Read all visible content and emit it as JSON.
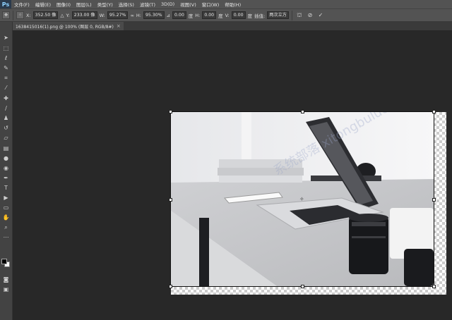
{
  "app": {
    "logo": "Ps"
  },
  "menu": [
    "文件(F)",
    "编辑(E)",
    "图像(I)",
    "图层(L)",
    "类型(Y)",
    "选择(S)",
    "滤镜(T)",
    "3D(D)",
    "视图(V)",
    "窗口(W)",
    "帮助(H)"
  ],
  "options": {
    "x_label": "X:",
    "x_value": "352.50 像",
    "y_label": "Y:",
    "y_value": "233.00 像",
    "w_label": "W:",
    "w_value": "95.27%",
    "h_label": "H:",
    "h_value": "95.30%",
    "angle_value": "0.00",
    "angle_unit": "度",
    "hskew_label": "H:",
    "hskew_value": "0.00",
    "hskew_unit": "度",
    "vskew_label": "V:",
    "vskew_value": "0.00",
    "vskew_unit": "度",
    "interp_label": "插值:",
    "interp_value": "两次立方"
  },
  "document": {
    "tab_title": "1638415016(1).png @ 100% (图层 0, RGB/8#)",
    "close": "×"
  },
  "icons": {
    "move": "move-tool-icon",
    "link": "link-icon",
    "angle": "angle-icon",
    "warp": "warp-icon",
    "cancel": "cancel-icon",
    "commit": "commit-icon"
  },
  "watermark": "系统部落 xitongbuluo.com"
}
